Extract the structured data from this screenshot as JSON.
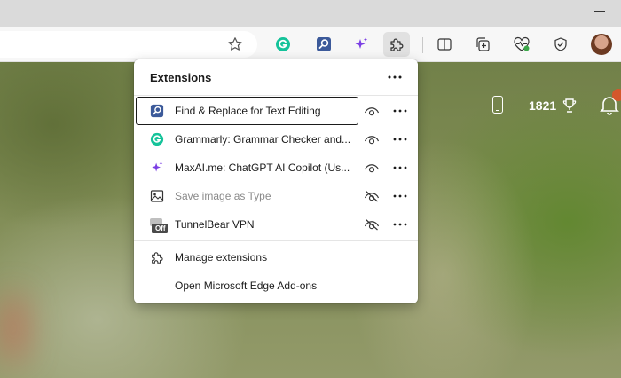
{
  "panel": {
    "title": "Extensions",
    "extensions": [
      {
        "label": "Find & Replace for Text Editing",
        "icon": "find-replace-icon",
        "visible": true,
        "enabled": true
      },
      {
        "label": "Grammarly: Grammar Checker and...",
        "icon": "grammarly-icon",
        "visible": true,
        "enabled": true
      },
      {
        "label": "MaxAI.me: ChatGPT AI Copilot (Us...",
        "icon": "maxai-sparkle-icon",
        "visible": true,
        "enabled": true
      },
      {
        "label": "Save image as Type",
        "icon": "image-icon",
        "visible": false,
        "enabled": false
      },
      {
        "label": "TunnelBear VPN",
        "icon": "tunnelbear-icon",
        "visible": false,
        "enabled": true,
        "badge": "Off"
      }
    ],
    "manage_label": "Manage extensions",
    "addons_label": "Open Microsoft Edge Add-ons"
  },
  "page": {
    "points": "1821"
  },
  "colors": {
    "grammarly": "#15c39a",
    "find_replace": "#3c5a9a",
    "maxai": "#7b3fe4",
    "notification": "#d4572b"
  }
}
